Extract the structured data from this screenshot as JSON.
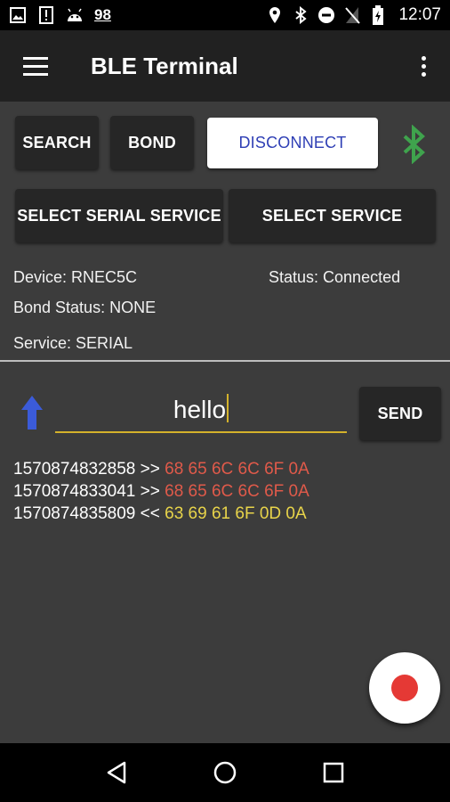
{
  "status_bar": {
    "notification_count": "98",
    "time": "12:07",
    "icons": [
      "image-icon",
      "alert-icon",
      "android-icon",
      "location-icon",
      "bluetooth-icon",
      "dnd-icon",
      "no-sim-icon",
      "battery-icon"
    ]
  },
  "app_bar": {
    "title": "BLE Terminal",
    "menu_icon": "hamburger-menu-icon",
    "overflow_icon": "more-vert-icon"
  },
  "buttons": {
    "search": "SEARCH",
    "bond": "BOND",
    "disconnect": "DISCONNECT",
    "select_serial_service": "SELECT SERIAL SERVICE",
    "select_service": "SELECT SERVICE"
  },
  "info": {
    "device": "Device: RNEC5C",
    "status": "Status: Connected",
    "bond_status": "Bond Status: NONE",
    "service": "Service: SERIAL"
  },
  "input": {
    "value": "hello"
  },
  "send_button": "SEND",
  "log": [
    {
      "timestamp": "1570874832858",
      "direction": ">>",
      "hex": "68 65 6C 6C 6F 0A"
    },
    {
      "timestamp": "1570874833041",
      "direction": ">>",
      "hex": "68 65 6C 6C 6F 0A"
    },
    {
      "timestamp": "1570874835809",
      "direction": "<<",
      "hex": "63 69 61 6F 0D 0A"
    }
  ],
  "colors": {
    "accent": "#d4b22b",
    "bluetooth": "#3fa34d",
    "sent_hex": "#e05a4a",
    "received_hex": "#e8d44a",
    "record": "#e53935"
  }
}
